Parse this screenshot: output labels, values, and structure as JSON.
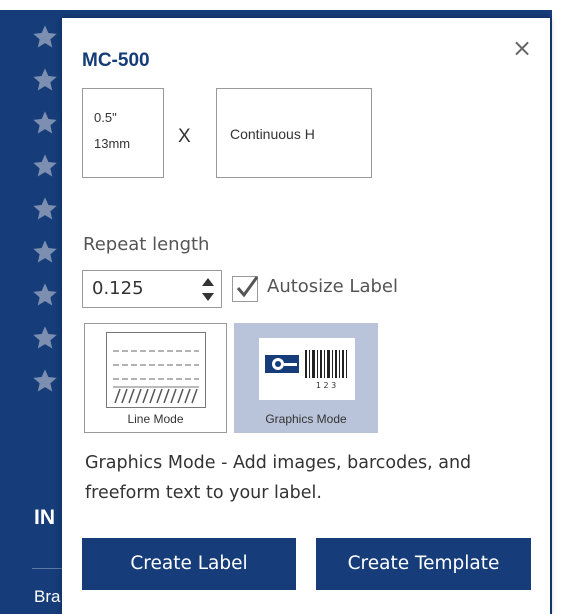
{
  "background": {
    "heading": "IN",
    "subtext": "Bra",
    "star_count": 9,
    "right_icon": "arrow-icon"
  },
  "popup": {
    "title": "MC-500",
    "close_label": "×",
    "width_box": {
      "inches": "0.5\"",
      "mm": "13mm"
    },
    "times_symbol": "X",
    "length_box": "Continuous H",
    "repeat": {
      "label": "Repeat length",
      "value": "0.125"
    },
    "autosize": {
      "label": "Autosize Label",
      "checked": true
    },
    "modes": [
      {
        "label": "Line Mode",
        "selected": false,
        "icon": "line-mode-icon"
      },
      {
        "label": "Graphics Mode",
        "selected": true,
        "icon": "graphics-mode-icon"
      }
    ],
    "graphics_icon_digits": "1 2 3",
    "description": "Graphics Mode - Add images, barcodes, and freeform text to your label.",
    "buttons": {
      "create_label": "Create Label",
      "create_template": "Create Template"
    }
  },
  "colors": {
    "brand_blue": "#163d7a",
    "selected_mode_bg": "#b9c4da"
  }
}
